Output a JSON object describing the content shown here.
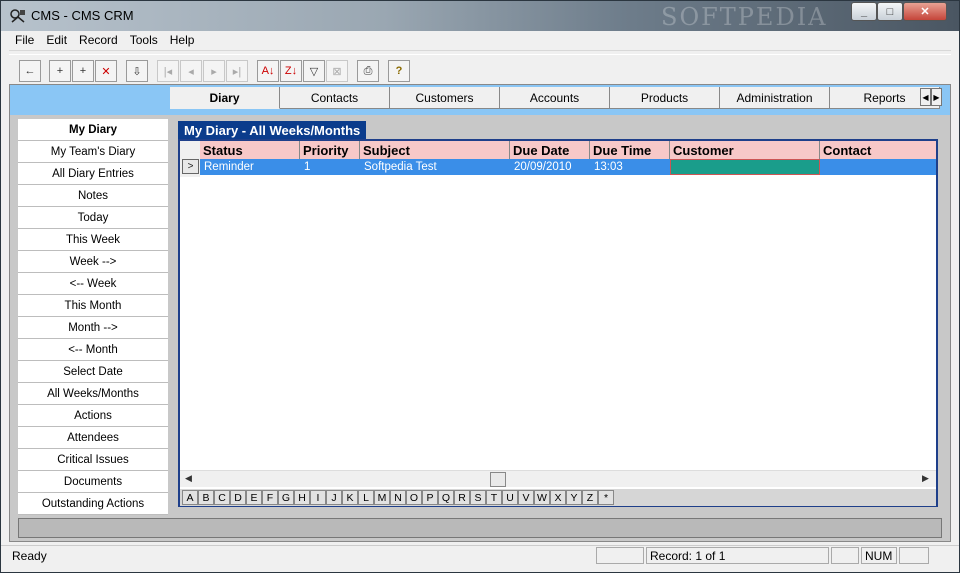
{
  "window": {
    "title": "CMS - CMS CRM",
    "watermark": "SOFTPEDIA"
  },
  "menu": {
    "items": [
      "File",
      "Edit",
      "Record",
      "Tools",
      "Help"
    ]
  },
  "toolbar": {
    "buttons": [
      {
        "icon": "back-arrow-icon",
        "glyph": "←"
      },
      {
        "icon": "new-record-icon",
        "glyph": "+"
      },
      {
        "icon": "new-child-record-icon",
        "glyph": "+"
      },
      {
        "icon": "delete-record-icon",
        "glyph": "✕"
      },
      {
        "icon": "save-record-icon",
        "glyph": "⇩"
      },
      {
        "icon": "first-record-icon",
        "glyph": "|◂"
      },
      {
        "icon": "previous-record-icon",
        "glyph": "◂"
      },
      {
        "icon": "next-record-icon",
        "glyph": "▸"
      },
      {
        "icon": "last-record-icon",
        "glyph": "▸|"
      },
      {
        "icon": "sort-ascending-icon",
        "glyph": "A↓"
      },
      {
        "icon": "sort-descending-icon",
        "glyph": "Z↓"
      },
      {
        "icon": "filter-icon",
        "glyph": "▽"
      },
      {
        "icon": "remove-filter-icon",
        "glyph": "⊠"
      },
      {
        "icon": "print-icon",
        "glyph": "⎙"
      },
      {
        "icon": "help-icon",
        "glyph": "?"
      }
    ]
  },
  "tabs": {
    "items": [
      "Diary",
      "Contacts",
      "Customers",
      "Accounts",
      "Products",
      "Administration",
      "Reports"
    ],
    "active": "Diary"
  },
  "sidebar": {
    "items": [
      "My Diary",
      "My Team's Diary",
      "All Diary Entries",
      "Notes",
      "Today",
      "This Week",
      "Week -->",
      "<-- Week",
      "This Month",
      "Month -->",
      "<-- Month",
      "Select Date",
      "All Weeks/Months",
      "Actions",
      "Attendees",
      "Critical Issues",
      "Documents",
      "Outstanding Actions"
    ],
    "active": "My Diary"
  },
  "view": {
    "title": "My Diary - All Weeks/Months"
  },
  "grid": {
    "columns": [
      "Status",
      "Priority",
      "Subject",
      "Due Date",
      "Due Time",
      "Customer",
      "Contact"
    ],
    "rows": [
      [
        "Reminder",
        "1",
        "Softpedia Test",
        "20/09/2010",
        "13:03",
        "",
        ""
      ]
    ],
    "row_marker": ">",
    "highlight_color": "#3a8ee8",
    "customer_cell_color": "#1a9d8b"
  },
  "alphabet": [
    "A",
    "B",
    "C",
    "D",
    "E",
    "F",
    "G",
    "H",
    "I",
    "J",
    "K",
    "L",
    "M",
    "N",
    "O",
    "P",
    "Q",
    "R",
    "S",
    "T",
    "U",
    "V",
    "W",
    "X",
    "Y",
    "Z",
    "*"
  ],
  "status": {
    "left": "Ready",
    "record": "Record: 1 of 1",
    "num": "NUM"
  },
  "colors": {
    "tabstrip": "#8ac6f5",
    "header_row": "#f7c8c8",
    "view_tab": "#0b3c8c"
  }
}
